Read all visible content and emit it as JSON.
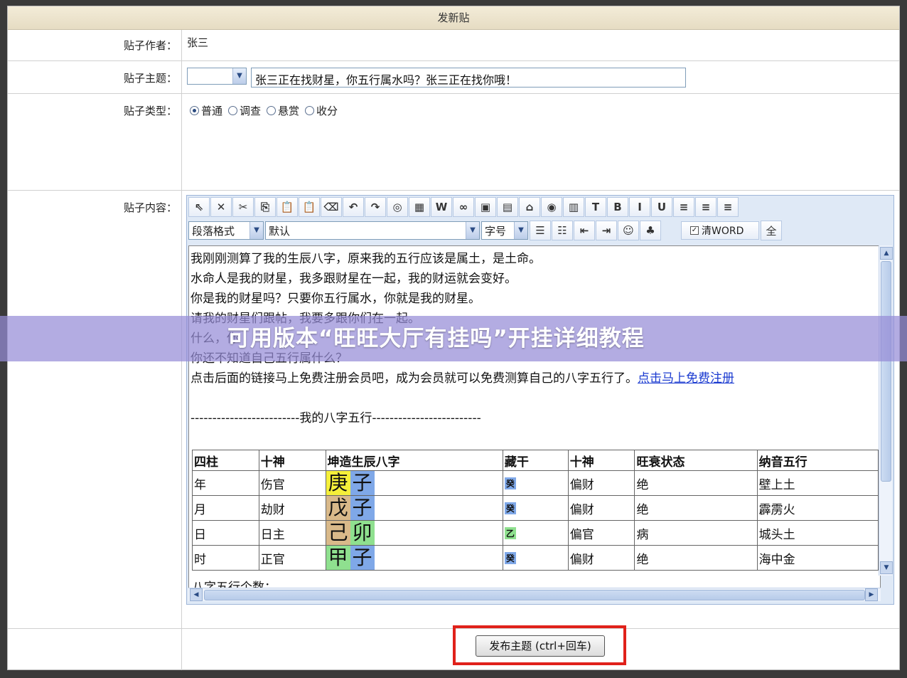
{
  "form": {
    "title": "发新贴",
    "author_label": "贴子作者：",
    "author_value": "张三",
    "subject_label": "贴子主题：",
    "subject_value": "张三正在找财星，你五行属水吗？张三正在找你哦！",
    "type_label": "贴子类型：",
    "types": [
      {
        "label": "普通",
        "selected": true
      },
      {
        "label": "调查",
        "selected": false
      },
      {
        "label": "悬赏",
        "selected": false
      },
      {
        "label": "收分",
        "selected": false
      }
    ],
    "content_label": "贴子内容："
  },
  "toolbar": {
    "row1_icons": [
      "pointer-icon",
      "delete-icon",
      "cut-icon",
      "copy-icon",
      "paste-icon",
      "paste-text-icon",
      "eraser-icon",
      "undo-icon",
      "redo-icon",
      "page-icon",
      "table-icon",
      "web-icon",
      "link-icon",
      "image-icon",
      "picture-icon",
      "upload-icon",
      "media-icon",
      "form-icon",
      "text-color-icon",
      "bold-icon",
      "italic-icon",
      "underline-icon",
      "align-left-icon",
      "align-center-icon",
      "align-right-icon"
    ],
    "row1_glyphs": [
      "⇖",
      "✕",
      "✂",
      "⎘",
      "📋",
      "📋",
      "⌫",
      "↶",
      "↷",
      "◎",
      "▦",
      "W",
      "∞",
      "▣",
      "▤",
      "⌂",
      "◉",
      "▥",
      "T",
      "B",
      "I",
      "U",
      "≡",
      "≡",
      "≡"
    ],
    "paragraph_format": "段落格式",
    "font_default": "默认",
    "font_size": "字号",
    "row2_glyphs": [
      "☰",
      "☷",
      "⇤",
      "⇥",
      "☺",
      "♣"
    ],
    "row2_icons": [
      "ordered-list-icon",
      "unordered-list-icon",
      "outdent-icon",
      "indent-icon",
      "emoticon-icon",
      "find-icon"
    ],
    "clean_word": "清WORD",
    "fullscreen": "全"
  },
  "content": {
    "lines": [
      "我刚刚测算了我的生辰八字，原来我的五行应该是属土，是土命。",
      "水命人是我的财星，我多跟财星在一起，我的财运就会变好。",
      "你是我的财星吗？只要你五行属水，你就是我的财星。",
      "请我的财星们跟帖，我要多跟你们在一起。",
      "什么，你",
      "你还不知道自己五行属什么？"
    ],
    "cta_text": "点击后面的链接马上免费注册会员吧，成为会员就可以免费测算自己的八字五行了。",
    "cta_link": "点击马上免费注册",
    "separator": "-------------------------我的八字五行-------------------------",
    "table_headers": [
      "四柱",
      "十神",
      "坤造生辰八字",
      "藏干",
      "十神",
      "旺衰状态",
      "纳音五行"
    ],
    "table_rows": [
      {
        "pillar": "年",
        "shishen": "伤官",
        "stem": "庚",
        "branch": "子",
        "cang": "癸",
        "shishen2": "偏财",
        "state": "绝",
        "nayin": "壁上土",
        "stem_color": "#f5ef3a",
        "branch_color": "#7fa8e8",
        "cang_color": "#7fa8e8"
      },
      {
        "pillar": "月",
        "shishen": "劫财",
        "stem": "戊",
        "branch": "子",
        "cang": "癸",
        "shishen2": "偏财",
        "state": "绝",
        "nayin": "霹雳火",
        "stem_color": "#d9b98a",
        "branch_color": "#7fa8e8",
        "cang_color": "#7fa8e8"
      },
      {
        "pillar": "日",
        "shishen": "日主",
        "stem": "己",
        "branch": "卯",
        "cang": "乙",
        "shishen2": "偏官",
        "state": "病",
        "nayin": "城头土",
        "stem_color": "#d9b98a",
        "branch_color": "#8fe08f",
        "cang_color": "#8fe08f"
      },
      {
        "pillar": "时",
        "shishen": "正官",
        "stem": "甲",
        "branch": "子",
        "cang": "癸",
        "shishen2": "偏财",
        "state": "绝",
        "nayin": "海中金",
        "stem_color": "#8fe08f",
        "branch_color": "#7fa8e8",
        "cang_color": "#7fa8e8"
      }
    ],
    "footer_partial": "八字五行个数："
  },
  "submit": {
    "label": "发布主题 (ctrl+回车)"
  },
  "banner": {
    "text": "可用版本“旺旺大厅有挂吗”开挂详细教程"
  }
}
